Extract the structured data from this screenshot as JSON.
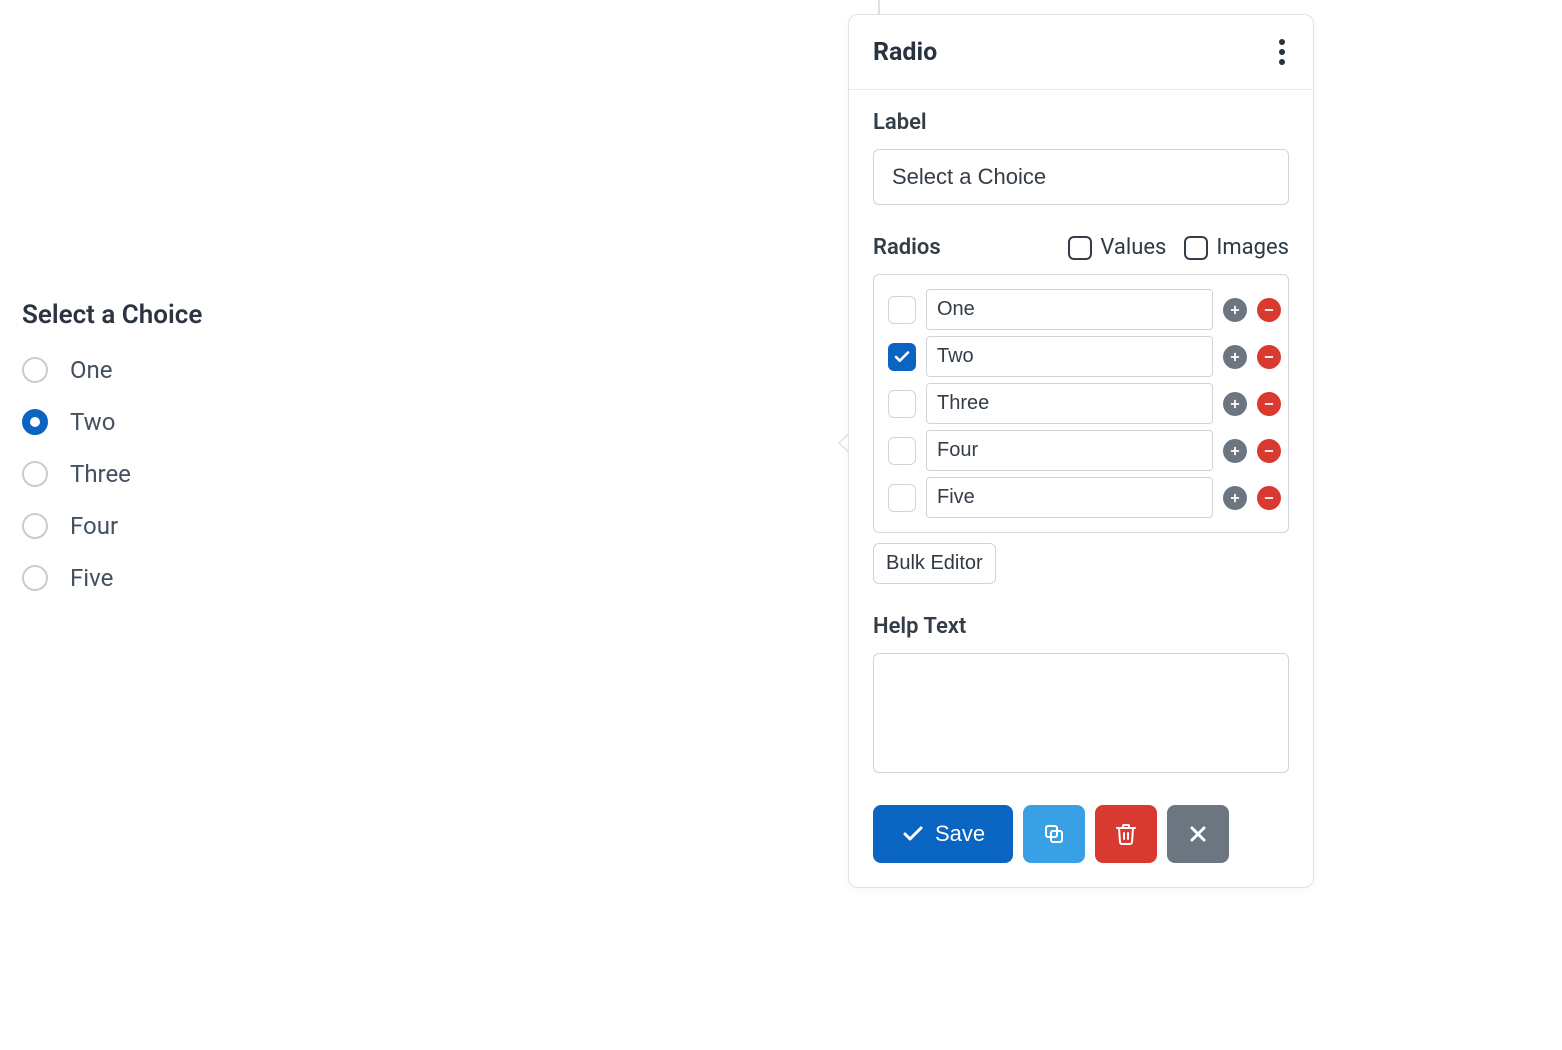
{
  "preview": {
    "title": "Select a Choice",
    "options": [
      {
        "label": "One",
        "selected": false
      },
      {
        "label": "Two",
        "selected": true
      },
      {
        "label": "Three",
        "selected": false
      },
      {
        "label": "Four",
        "selected": false
      },
      {
        "label": "Five",
        "selected": false
      }
    ]
  },
  "panel": {
    "title": "Radio",
    "label_heading": "Label",
    "label_value": "Select a Choice",
    "radios_heading": "Radios",
    "toggle_values": "Values",
    "toggle_images": "Images",
    "options": [
      {
        "value": "One",
        "default": false
      },
      {
        "value": "Two",
        "default": true
      },
      {
        "value": "Three",
        "default": false
      },
      {
        "value": "Four",
        "default": false
      },
      {
        "value": "Five",
        "default": false
      }
    ],
    "bulk_editor_label": "Bulk Editor",
    "help_text_heading": "Help Text",
    "help_text_value": "",
    "save_label": "Save"
  },
  "colors": {
    "primary": "#0a64c2",
    "danger": "#d93a30",
    "info": "#39a0e5",
    "gray": "#6c7680"
  }
}
